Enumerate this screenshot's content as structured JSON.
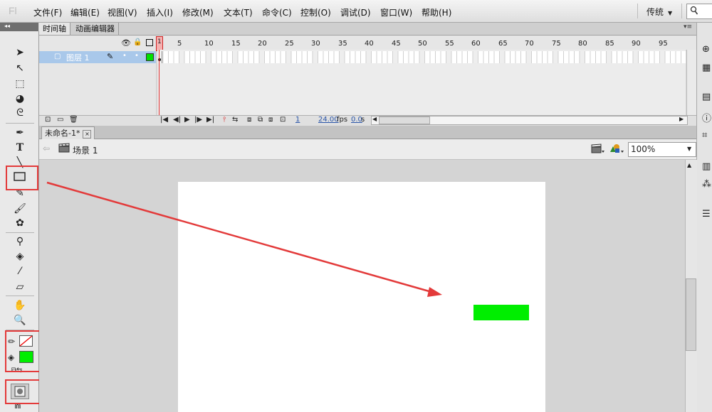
{
  "app": {
    "logo": "Fl"
  },
  "menu": [
    "文件(F)",
    "编辑(E)",
    "视图(V)",
    "插入(I)",
    "修改(M)",
    "文本(T)",
    "命令(C)",
    "控制(O)",
    "调试(D)",
    "窗口(W)",
    "帮助(H)"
  ],
  "workspace": "传统",
  "timeline": {
    "tabs": [
      "时间轴",
      "动画编辑器"
    ],
    "layer_name": "图层 1",
    "current_frame": "1",
    "ruler": [
      "5",
      "10",
      "15",
      "20",
      "25",
      "30",
      "35",
      "40",
      "45",
      "50",
      "55",
      "60",
      "65",
      "70",
      "75",
      "80",
      "85",
      "90",
      "95"
    ],
    "status_frame": "1",
    "fps": "24.00",
    "fps_unit": "fps",
    "time": "0.0",
    "time_unit": "s"
  },
  "document": {
    "tab_name": "未命名-1*",
    "close": "×"
  },
  "editbar": {
    "scene": "场景 1",
    "zoom": "100%"
  },
  "stage": {
    "fill_color": "#00ee00",
    "background": "#ffffff"
  },
  "colors": {
    "annotation_red": "#e33a3a",
    "stroke_none": "none",
    "fill": "#00ee00"
  }
}
